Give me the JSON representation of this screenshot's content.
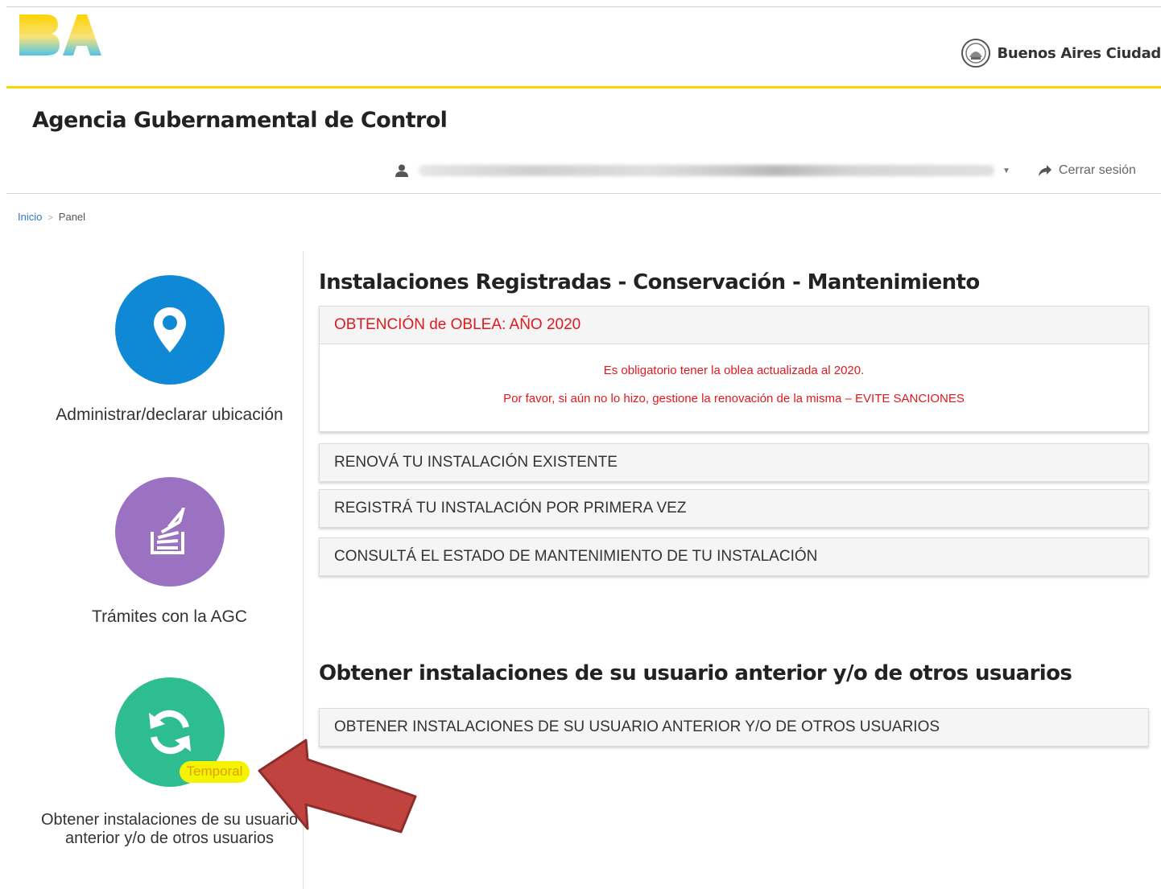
{
  "header": {
    "city_name": "Buenos Aires Ciudad",
    "agency_title": "Agencia Gubernamental de Control",
    "logout_label": "Cerrar sesión"
  },
  "breadcrumb": {
    "home": "Inicio",
    "separator": ">",
    "current": "Panel"
  },
  "tiles": [
    {
      "label": "Administrar/declarar ubicación",
      "color": "#0f88d6",
      "icon": "location-pin-icon"
    },
    {
      "label": "Trámites con la AGC",
      "color": "#9b71c1",
      "icon": "stack-documents-icon"
    },
    {
      "label": "Obtener instalaciones de su usuario anterior y/o de otros usuarios",
      "color": "#2dbd90",
      "icon": "refresh-icon",
      "badge": "Temporal"
    }
  ],
  "sections": [
    {
      "title": "Instalaciones Registradas - Conservación - Mantenimiento",
      "notice": {
        "title": "OBTENCIÓN de OBLEA: AÑO 2020",
        "line1": "Es obligatorio tener la oblea actualizada al 2020.",
        "line2": "Por favor, si aún no lo hizo, gestione la renovación de la misma – EVITE SANCIONES"
      },
      "items": [
        "RENOVÁ TU INSTALACIÓN EXISTENTE",
        "REGISTRÁ TU INSTALACIÓN POR PRIMERA VEZ",
        "CONSULTÁ EL ESTADO DE MANTENIMIENTO DE TU INSTALACIÓN"
      ]
    },
    {
      "title": "Obtener instalaciones de su usuario anterior y/o de otros usuarios",
      "items": [
        "OBTENER INSTALACIONES DE SU USUARIO ANTERIOR Y/O DE OTROS USUARIOS"
      ]
    }
  ],
  "colors": {
    "accent_yellow": "#f5d800",
    "alert_red": "#e0191f",
    "link_blue": "#2a7bc4",
    "arrow_red": "#c0433f"
  }
}
